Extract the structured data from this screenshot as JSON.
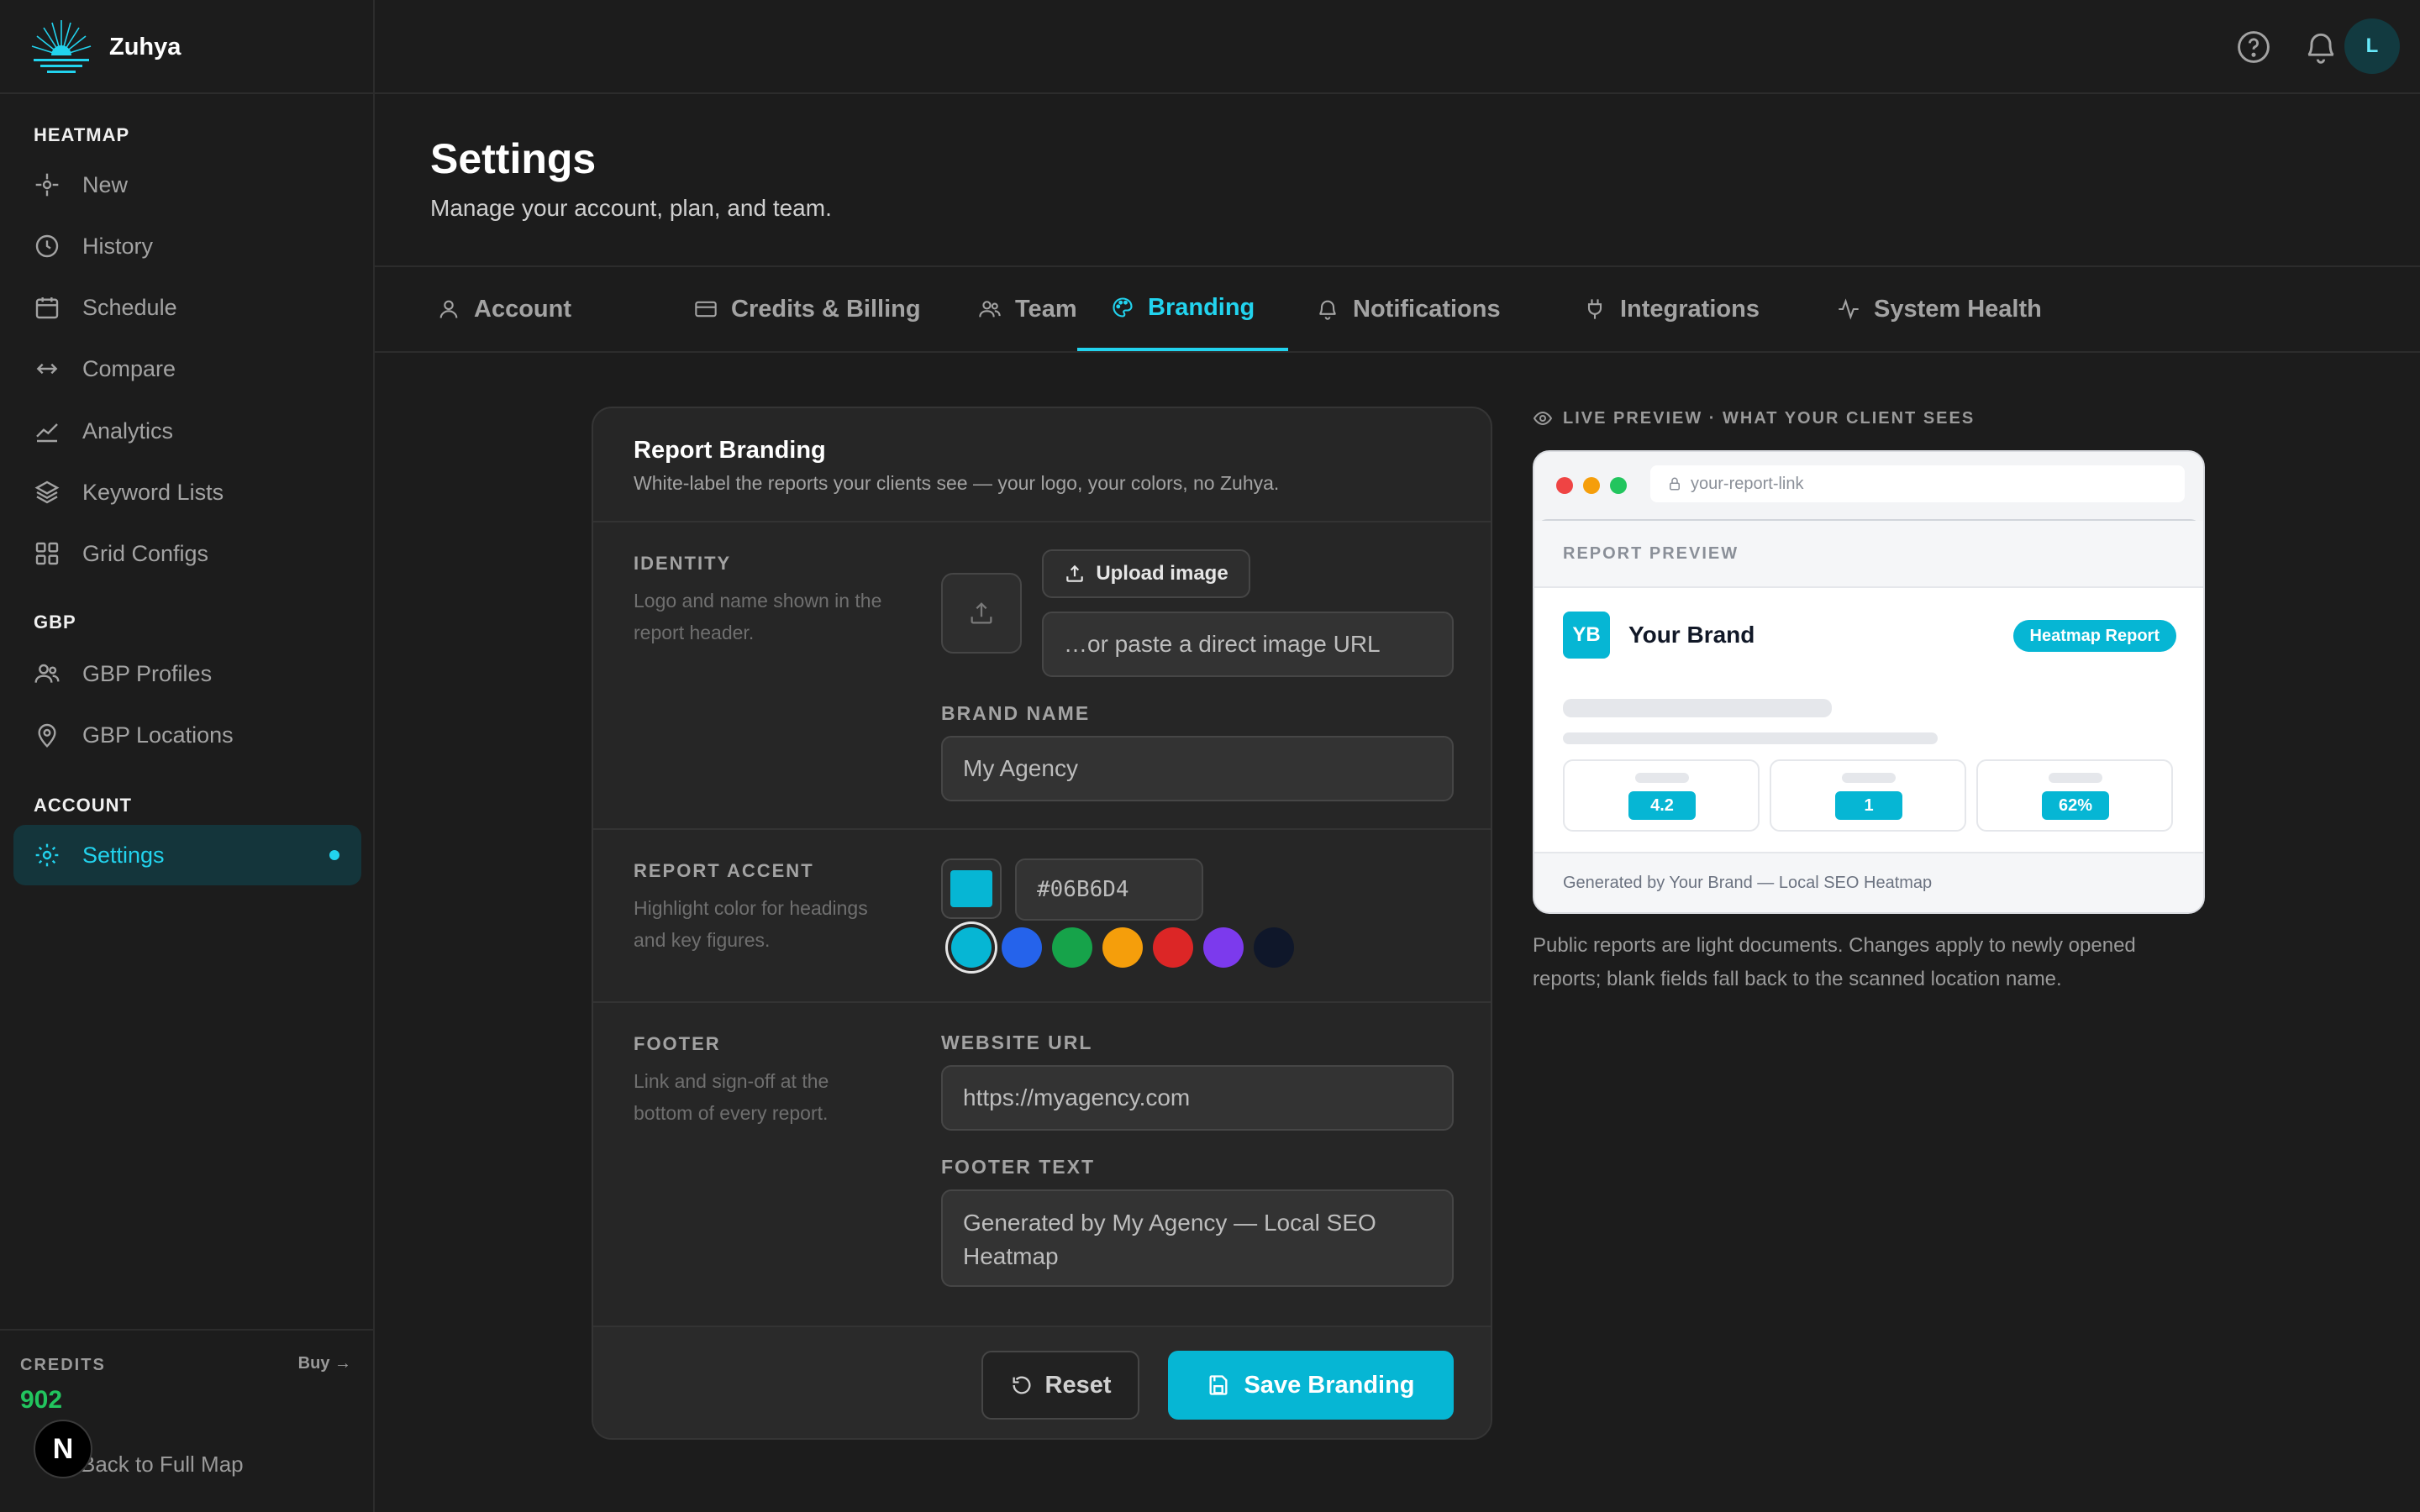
{
  "app": {
    "name": "Zuhya"
  },
  "sidebar": {
    "sections": [
      {
        "title": "HEATMAP",
        "items": [
          {
            "label": "New",
            "icon": "crosshair-icon"
          },
          {
            "label": "History",
            "icon": "clock-icon"
          },
          {
            "label": "Schedule",
            "icon": "calendar-icon"
          },
          {
            "label": "Compare",
            "icon": "arrows-horizontal-icon"
          },
          {
            "label": "Analytics",
            "icon": "chart-line-icon"
          },
          {
            "label": "Keyword Lists",
            "icon": "layers-icon"
          },
          {
            "label": "Grid Configs",
            "icon": "grid-icon"
          }
        ]
      },
      {
        "title": "GBP",
        "items": [
          {
            "label": "GBP Profiles",
            "icon": "users-icon"
          },
          {
            "label": "GBP Locations",
            "icon": "map-pin-icon"
          }
        ]
      },
      {
        "title": "ACCOUNT",
        "items": [
          {
            "label": "Settings",
            "icon": "gear-icon",
            "active": true
          }
        ]
      }
    ],
    "credits": {
      "label": "CREDITS",
      "buy": "Buy →",
      "value": "902"
    },
    "back_link": "Back to Full Map",
    "next_badge": "N"
  },
  "topbar": {
    "avatar_initial": "L"
  },
  "header": {
    "title": "Settings",
    "subtitle": "Manage your account, plan, and team."
  },
  "tabs": [
    {
      "label": "Account",
      "icon": "user-icon"
    },
    {
      "label": "Credits & Billing",
      "icon": "credit-card-icon"
    },
    {
      "label": "Team",
      "icon": "users-icon"
    },
    {
      "label": "Branding",
      "icon": "palette-icon",
      "active": true
    },
    {
      "label": "Notifications",
      "icon": "bell-icon"
    },
    {
      "label": "Integrations",
      "icon": "plug-icon"
    },
    {
      "label": "System Health",
      "icon": "activity-icon"
    }
  ],
  "branding": {
    "title": "Report Branding",
    "subtitle": "White-label the reports your clients see — your logo, your colors, no Zuhya.",
    "identity": {
      "label": "IDENTITY",
      "desc": "Logo and name shown in the report header.",
      "upload_label": "Upload image",
      "image_url_placeholder": "…or paste a direct image URL",
      "brand_name_label": "BRAND NAME",
      "brand_name_value": "My Agency"
    },
    "accent": {
      "label": "REPORT ACCENT",
      "desc": "Highlight color for headings and key figures.",
      "hex_value": "#06B6D4",
      "swatches": [
        "#06b6d4",
        "#2563eb",
        "#16a34a",
        "#f59e0b",
        "#dc2626",
        "#7c3aed",
        "#0f172a"
      ]
    },
    "footer": {
      "label": "FOOTER",
      "desc": "Link and sign-off at the bottom of every report.",
      "website_label": "WEBSITE URL",
      "website_value": "https://myagency.com",
      "footer_text_label": "FOOTER TEXT",
      "footer_text_value": "Generated by My Agency — Local SEO Heatmap"
    },
    "reset_label": "Reset",
    "save_label": "Save Branding"
  },
  "preview": {
    "label": "LIVE PREVIEW · WHAT YOUR CLIENT SEES",
    "url": "your-report-link",
    "report_label": "REPORT PREVIEW",
    "logo_initials": "YB",
    "brand_name": "Your Brand",
    "pill": "Heatmap Report",
    "stats": [
      "4.2",
      "1",
      "62%"
    ],
    "footer": "Generated by Your Brand — Local SEO Heatmap",
    "note": "Public reports are light documents. Changes apply to newly opened reports; blank fields fall back to the scanned location name."
  }
}
